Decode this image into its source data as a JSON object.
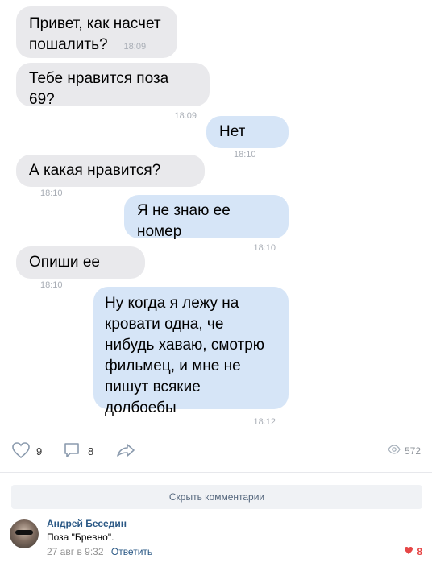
{
  "messages": [
    {
      "lines": [
        "Привет, как насчет",
        "пошалить?"
      ],
      "time": "18:09",
      "side": "in"
    },
    {
      "lines": [
        "Тебе нравится поза 69?"
      ],
      "time": "18:09",
      "side": "in"
    },
    {
      "lines": [
        "Нет"
      ],
      "time": "18:10",
      "side": "out"
    },
    {
      "lines": [
        "А какая нравится?"
      ],
      "time": "18:10",
      "side": "in"
    },
    {
      "lines": [
        "Я не знаю ее номер"
      ],
      "time": "18:10",
      "side": "out"
    },
    {
      "lines": [
        "Опиши ее"
      ],
      "time": "18:10",
      "side": "in"
    },
    {
      "lines": [
        "Ну когда я лежу на",
        "кровати одна, че",
        "нибудь хаваю, смотрю",
        "фильмец, и мне не",
        "пишут всякие долбоебы"
      ],
      "time": "18:12",
      "side": "out"
    }
  ],
  "post_actions": {
    "likes_count": "9",
    "comments_count": "8",
    "views_count": "572"
  },
  "hide_comments_label": "Скрыть комментарии",
  "comment": {
    "author": "Андрей Беседин",
    "text": "Поза \"Бревно\".",
    "date": "27 авг в 9:32",
    "reply_label": "Ответить",
    "likes": "8"
  },
  "colors": {
    "incoming_bubble": "#e9e9ec",
    "outgoing_bubble": "#d6e5f7",
    "link": "#2a5885",
    "like_red": "#e64646"
  }
}
